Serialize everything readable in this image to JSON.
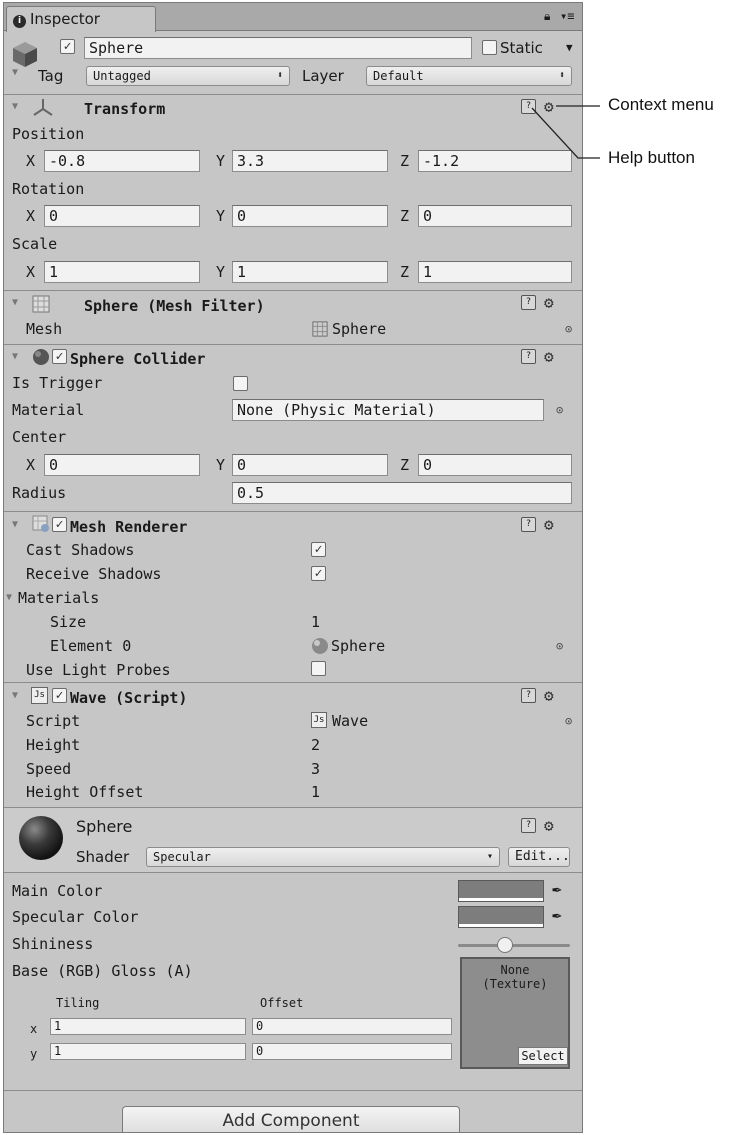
{
  "window": {
    "tab_title": "Inspector"
  },
  "object": {
    "name": "Sphere",
    "static_label": "Static",
    "tag_label": "Tag",
    "tag_value": "Untagged",
    "layer_label": "Layer",
    "layer_value": "Default"
  },
  "transform": {
    "title": "Transform",
    "position_label": "Position",
    "rotation_label": "Rotation",
    "scale_label": "Scale",
    "x": "X",
    "y": "Y",
    "z": "Z",
    "position": {
      "x": "-0.8",
      "y": "3.3",
      "z": "-1.2"
    },
    "rotation": {
      "x": "0",
      "y": "0",
      "z": "0"
    },
    "scale": {
      "x": "1",
      "y": "1",
      "z": "1"
    }
  },
  "mesh_filter": {
    "title": "Sphere (Mesh Filter)",
    "mesh_label": "Mesh",
    "mesh_value": "Sphere"
  },
  "sphere_collider": {
    "title": "Sphere Collider",
    "is_trigger_label": "Is Trigger",
    "material_label": "Material",
    "material_value": "None (Physic Material)",
    "center_label": "Center",
    "center": {
      "x": "0",
      "y": "0",
      "z": "0"
    },
    "radius_label": "Radius",
    "radius_value": "0.5"
  },
  "mesh_renderer": {
    "title": "Mesh Renderer",
    "cast_shadows_label": "Cast Shadows",
    "receive_shadows_label": "Receive Shadows",
    "materials_label": "Materials",
    "size_label": "Size",
    "size_value": "1",
    "element0_label": "Element 0",
    "element0_value": "Sphere",
    "light_probes_label": "Use Light Probes"
  },
  "wave_script": {
    "title": "Wave (Script)",
    "script_label": "Script",
    "script_value": "Wave",
    "height_label": "Height",
    "height_value": "2",
    "speed_label": "Speed",
    "speed_value": "3",
    "height_offset_label": "Height Offset",
    "height_offset_value": "1"
  },
  "material": {
    "name": "Sphere",
    "shader_label": "Shader",
    "shader_value": "Specular",
    "edit_label": "Edit...",
    "main_color_label": "Main Color",
    "specular_color_label": "Specular Color",
    "shininess_label": "Shininess",
    "base_label": "Base (RGB) Gloss (A)",
    "tiling_label": "Tiling",
    "offset_label": "Offset",
    "x_label": "x",
    "y_label": "y",
    "tiling_x": "1",
    "tiling_y": "1",
    "offset_x": "0",
    "offset_y": "0",
    "texture_none": "None",
    "texture_type": "(Texture)",
    "select_label": "Select"
  },
  "add_component_label": "Add Component",
  "callouts": {
    "context_menu": "Context menu",
    "help_button": "Help button"
  },
  "icons": [
    "info-icon",
    "lock-icon",
    "menu-icon",
    "cube-icon",
    "transform-icon",
    "help-icon",
    "gear-icon",
    "mesh-filter-icon",
    "sphere-icon",
    "mesh-renderer-icon",
    "js-script-icon",
    "target-icon",
    "eyedropper-icon"
  ]
}
